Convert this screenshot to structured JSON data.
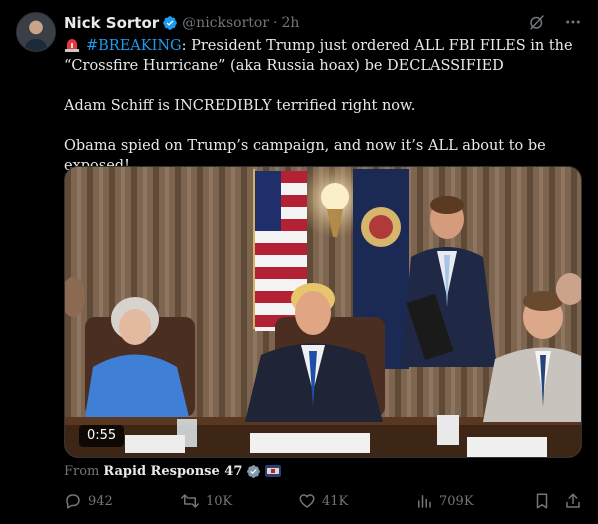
{
  "post": {
    "author": {
      "display_name": "Nick Sortor",
      "handle": "@nicksortor",
      "time": "2h",
      "separator": "·"
    },
    "text": {
      "hashtag": "#BREAKING",
      "line1_rest": ": President Trump just ordered ALL FBI FILES in the “Crossfire Hurricane” (aka Russia hoax) be DECLASSIFIED",
      "line2": "Adam Schiff is INCREDIBLY terrified right now.",
      "line3": "Obama spied on Trump’s campaign, and now it’s ALL about to be exposed!"
    },
    "media": {
      "duration": "0:55"
    },
    "source": {
      "prefix": "From",
      "name": "Rapid Response 47"
    },
    "actions": {
      "replies": "942",
      "reposts": "10K",
      "likes": "41K",
      "views": "709K"
    }
  },
  "icons": {
    "verified": "verified-badge-icon",
    "grok": "grok-icon",
    "more": "more-icon",
    "siren": "siren-icon",
    "reply": "reply-icon",
    "repost": "repost-icon",
    "like": "like-icon",
    "views": "views-icon",
    "bookmark": "bookmark-icon",
    "share": "share-icon"
  },
  "colors": {
    "background": "#000000",
    "text": "#e7e9ea",
    "secondary": "#71767b",
    "accent": "#1d9bf0"
  }
}
